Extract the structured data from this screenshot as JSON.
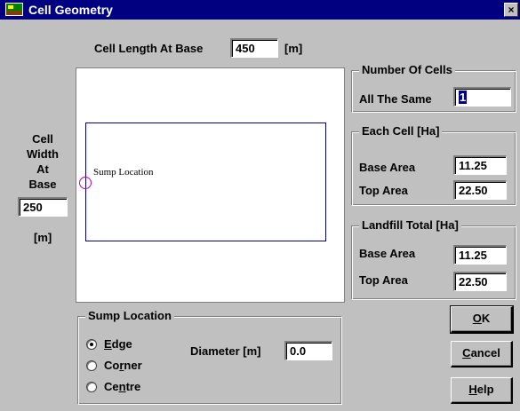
{
  "window": {
    "title": "Cell Geometry",
    "close_glyph": "×",
    "icon": "landfill-app-icon"
  },
  "cell_length": {
    "label": "Cell Length At Base",
    "value": "450",
    "unit": "[m]"
  },
  "cell_width": {
    "label_lines": [
      "Cell",
      "Width",
      "At",
      "Base"
    ],
    "value": "250",
    "unit": "[m]"
  },
  "preview": {
    "sump_label": "Sump Location",
    "marker_color": "#c000c0",
    "rect_color": "#000080"
  },
  "number_of_cells": {
    "title": "Number Of Cells",
    "label": "All The Same",
    "value": "1"
  },
  "each_cell": {
    "title": "Each Cell [Ha]",
    "base_label": "Base Area",
    "base_value": "11.25",
    "top_label": "Top Area",
    "top_value": "22.50"
  },
  "landfill_total": {
    "title": "Landfill Total [Ha]",
    "base_label": "Base Area",
    "base_value": "11.25",
    "top_label": "Top Area",
    "top_value": "22.50"
  },
  "sump_location": {
    "title": "Sump Location",
    "options": [
      {
        "pre": "",
        "ul": "E",
        "post": "dge",
        "checked": true
      },
      {
        "pre": "Co",
        "ul": "r",
        "post": "ner",
        "checked": false
      },
      {
        "pre": "Ce",
        "ul": "n",
        "post": "tre",
        "checked": false
      }
    ],
    "diameter_label": "Diameter [m]",
    "diameter_value": "0.0"
  },
  "buttons": {
    "ok": {
      "ul": "O",
      "post": "K"
    },
    "cancel": {
      "ul": "C",
      "post": "ancel"
    },
    "help": {
      "ul": "H",
      "post": "elp"
    }
  },
  "colors": {
    "titlebar": "#000080",
    "face": "#c0c0c0"
  }
}
